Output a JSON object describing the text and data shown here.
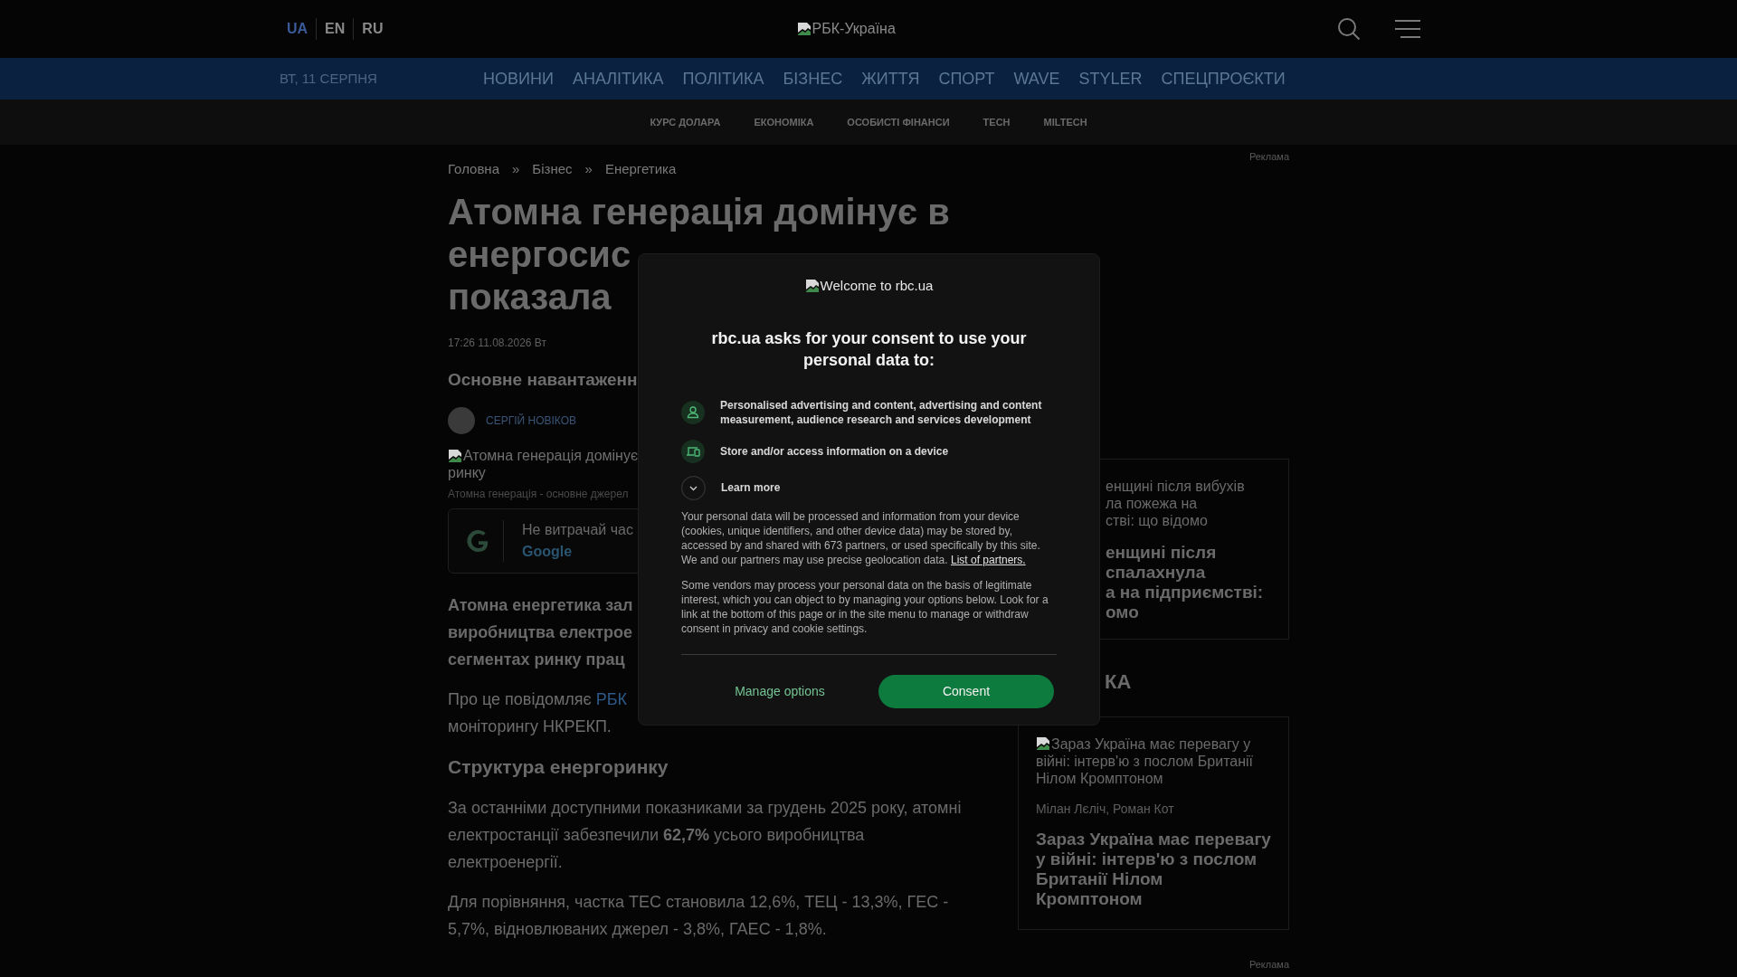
{
  "header": {
    "languages": [
      {
        "label": "UA",
        "selected": true
      },
      {
        "label": "EN",
        "selected": false
      },
      {
        "label": "RU",
        "selected": false
      }
    ],
    "logo_alt": "РБК-Україна"
  },
  "nav": {
    "date": "ВТ, 11 СЕРПНЯ",
    "items": [
      "НОВИНИ",
      "АНАЛІТИКА",
      "ПОЛІТИКА",
      "БІЗНЕС",
      "ЖИТТЯ",
      "СПОРТ",
      "WAVE",
      "STYLER",
      "СПЕЦПРОЄКТИ"
    ]
  },
  "subnav": [
    "КУРС ДОЛАРА",
    "ЕКОНОМІКА",
    "ОСОБИСТІ ФІНАНСИ",
    "TECH",
    "MILTECH"
  ],
  "article": {
    "breadcrumb": [
      "Головна",
      "»",
      "Бізнес",
      "»",
      "Енергетика"
    ],
    "title_lines": [
      "Атомна генерація домінує в",
      "енергосис",
      "показала"
    ],
    "date": "17:26 11.08.2026 Вт",
    "subtitle": "Основне навантаженн",
    "author": "СЕРГІЙ НОВІКОВ",
    "image_alt_lines": [
      "Атомна генерація домінує",
      "ринку"
    ],
    "caption": "Атомна генерація - основне джерел",
    "google": {
      "text": "Не витрачай час",
      "link": "Google"
    },
    "lead_lines": [
      "Атомна енергетика зал",
      "виробництва електрое",
      "сегментах ринку прац"
    ],
    "source": {
      "text": "Про це повідомляє ",
      "link": "РБК",
      "line2": "моніторингу НКРЕКП."
    },
    "heading": "Структура енергоринку",
    "paragraphs": [
      "За останніми доступними показниками за грудень 2025 року, атомні електростанції забезпечили **62,7%** усього виробництва електроенергії.",
      "Для порівняння, частка ТЕС становила 12,6%, ТЕЦ - 13,3%, ГЕС - 5,7%, відновлюваних джерел - 3,8%, ГАЕС - 1,8%."
    ]
  },
  "sidebar": {
    "ad_labels": [
      "Реклама",
      "Реклама"
    ],
    "card_1": {
      "image_alt_lines": [
        "енщині після вибухів",
        "ла пожежа на",
        "ствi: що відомо"
      ],
      "title_lines": [
        "енщині після",
        "спалахнула",
        "а на підприємстві:",
        "омо"
      ]
    },
    "section_heading": "КА",
    "card_2": {
      "image_alt": "Зараз Україна має перевагу у війні: інтерв'ю з послом Британії Нілом Кромптоном",
      "authors": "Мілан Лєліч, Роман Кот",
      "title": "Зараз Україна має перевагу у війні: інтерв'ю з послом Британії Нілом Кромптоном"
    }
  },
  "consent": {
    "logo_alt": "Welcome to rbc.ua",
    "heading": "rbc.ua asks for your consent to use your personal data to:",
    "purposes": [
      {
        "kind": "person",
        "text": "Personalised advertising and content, advertising and content measurement, audience research and services development"
      },
      {
        "kind": "device",
        "text": "Store and/or access information on a device"
      }
    ],
    "learn_more": {
      "label": "Learn more",
      "expanded": false
    },
    "paragraph_1": "Your personal data will be processed and information from your device (cookies, unique identifiers, and other device data) may be stored by, accessed by and shared with 673 partners, or used specifically by this site. We and our partners may use precise geolocation data. ",
    "partners_link": "List of partners.",
    "paragraph_2": "Some vendors may process your personal data on the basis of legitimate interest, which you can object to by managing your options below. Look for a link at the bottom of this page or in the site menu to manage or withdraw consent in privacy and cookie settings.",
    "buttons": [
      "Manage options",
      "Consent"
    ]
  }
}
